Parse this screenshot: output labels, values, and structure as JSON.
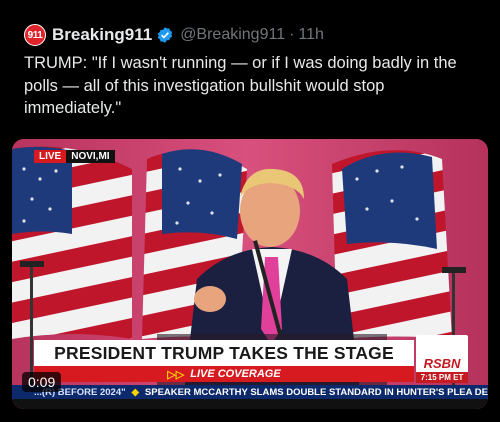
{
  "tweet": {
    "avatar_text": "911",
    "display_name": "Breaking911",
    "handle": "@Breaking911",
    "separator": "·",
    "time": "11h",
    "text": "TRUMP: \"If I wasn't running — or if I was doing badly in the polls — all of this investigation bullshit would stop immediately.\""
  },
  "video": {
    "live_label": "LIVE",
    "location": "NOVI,MI",
    "headline": "PRESIDENT TRUMP TAKES THE STAGE",
    "sub_headline": "LIVE COVERAGE",
    "sub_arrows": "▷▷",
    "network_logo": "RSBN",
    "clock": "7:15 PM ET",
    "ticker_left": "...(R) BEFORE 2024\"",
    "ticker_right": "SPEAKER MCCARTHY SLAMS DOUBLE STANDARD IN HUNTER'S PLEA DEA",
    "timecode": "0:09"
  },
  "colors": {
    "background": "#000000",
    "text_primary": "#e7e9ea",
    "text_secondary": "#71767b",
    "verified": "#1d9bf0",
    "live_red": "#d71920",
    "ticker_blue": "#0c2a6b"
  }
}
